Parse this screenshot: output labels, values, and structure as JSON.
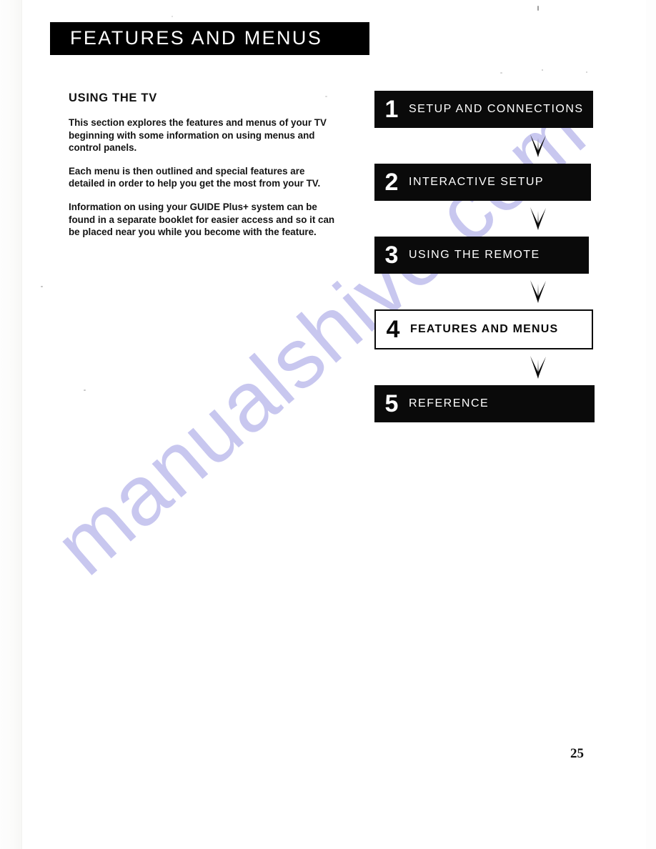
{
  "banner": {
    "title": "FEATURES AND MENUS"
  },
  "section": {
    "heading": "USING THE TV",
    "paragraphs": [
      "This section explores the features and menus of your TV beginning with some information on using menus and control panels.",
      "Each menu is then outlined and special features are detailed in order to help you get the most from your TV.",
      "Information on using your GUIDE Plus+ system can be found in a separate booklet for easier access and so it can be placed near you while you become with the feature."
    ]
  },
  "flowchart": {
    "steps": [
      {
        "number": "1",
        "label": "SETUP AND CONNECTIONS",
        "state": "dark"
      },
      {
        "number": "2",
        "label": "INTERACTIVE SETUP",
        "state": "dark"
      },
      {
        "number": "3",
        "label": "USING THE REMOTE",
        "state": "dark"
      },
      {
        "number": "4",
        "label": "FEATURES AND MENUS",
        "state": "current"
      },
      {
        "number": "5",
        "label": "REFERENCE",
        "state": "dark"
      }
    ]
  },
  "footer": {
    "page_number": "25"
  },
  "watermark": {
    "text": "manualshive.com",
    "color": "#c6c5ef"
  },
  "colors": {
    "ink": "#0a0a0a",
    "paper": "#ffffff",
    "banner_bg": "#000000",
    "banner_text": "#ffffff"
  }
}
